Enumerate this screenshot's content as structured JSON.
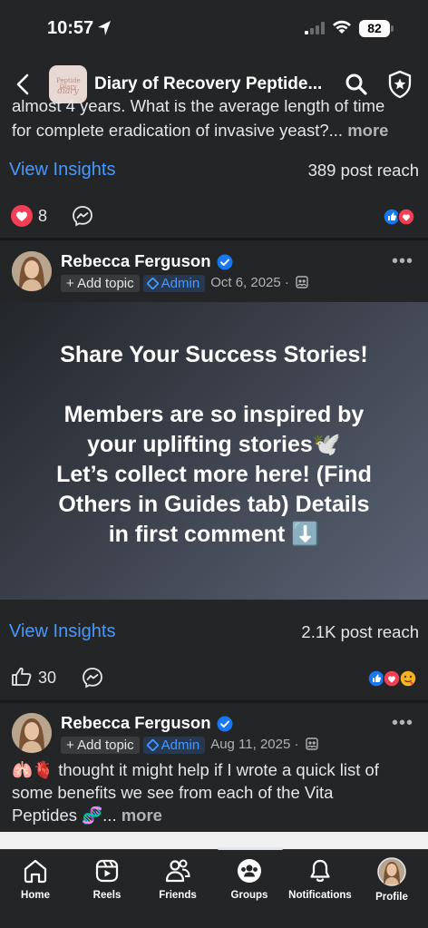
{
  "status_bar": {
    "time": "10:57",
    "battery": "82"
  },
  "header": {
    "title": "Diary of Recovery Peptide...",
    "thumb_line1": "Peptide Diary",
    "thumb_line2": "diary"
  },
  "post1": {
    "text_line1": "almost 4 years. What is the average length of time",
    "text_line2": "for complete eradication of invasive yeast?...",
    "more": "more",
    "insights": "View Insights",
    "reach": "389 post reach",
    "reaction_count": "8"
  },
  "post2": {
    "author": "Rebecca Ferguson",
    "add_topic": "+ Add topic",
    "admin": "Admin",
    "date": "Oct 6, 2025 ·",
    "banner_line1": "Share Your Success Stories!",
    "banner_line2": "Members are so inspired by",
    "banner_line3": "your uplifting stories🕊️",
    "banner_line4": "Let’s collect more here! (Find",
    "banner_line5": "Others in Guides tab) Details",
    "banner_line6": "in first comment ⬇️",
    "insights": "View Insights",
    "reach": "2.1K post reach",
    "reaction_count": "30"
  },
  "post3": {
    "author": "Rebecca Ferguson",
    "add_topic": "+ Add topic",
    "admin": "Admin",
    "date": "Aug 11, 2025 ·",
    "text_line1": "🫁🫀 thought it might help if I wrote a quick list of",
    "text_line2": "some benefits we see from each of the Vita",
    "text_line3": "Peptides 🧬...",
    "more": "more"
  },
  "nav": [
    {
      "label": "Home",
      "icon": "home-icon"
    },
    {
      "label": "Reels",
      "icon": "reels-icon"
    },
    {
      "label": "Friends",
      "icon": "friends-icon"
    },
    {
      "label": "Groups",
      "icon": "groups-icon"
    },
    {
      "label": "Notifications",
      "icon": "bell-icon"
    },
    {
      "label": "Profile",
      "icon": "profile-avatar"
    }
  ],
  "colors": {
    "link": "#4599ff",
    "background": "#242526",
    "like": "#1877f2",
    "love": "#f33e58"
  }
}
